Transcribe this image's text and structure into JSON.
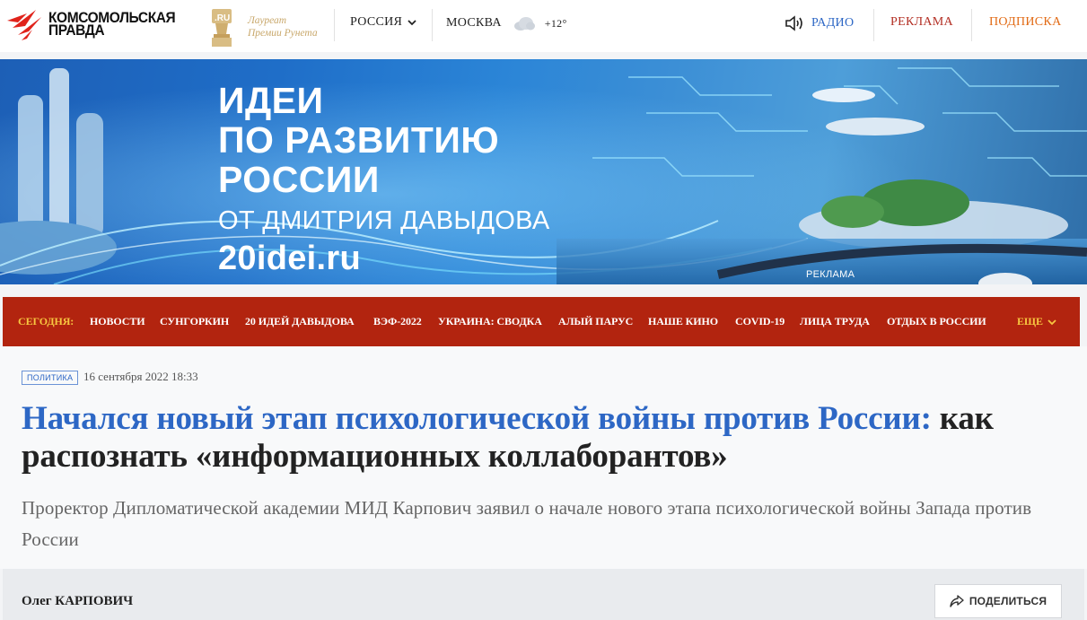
{
  "header": {
    "logo_line1": "КОМСОМОЛЬСКАЯ",
    "logo_line2": "ПРАВДА",
    "award_badge": ".RU",
    "award_line1": "Лауреат",
    "award_line2": "Премии Рунета",
    "region": "РОССИЯ",
    "city": "МОСКВА",
    "temperature": "+12°",
    "radio": "РАДИО",
    "reklama": "РЕКЛАМА",
    "podpiska": "ПОДПИСКА"
  },
  "banner": {
    "line1": "ИДЕИ",
    "line2": "ПО РАЗВИТИЮ",
    "line3": "РОССИИ",
    "line4": "ОТ ДМИТРИЯ ДАВЫДОВА",
    "url": "20idei.ru",
    "ad_label": "РЕКЛАМА"
  },
  "nav": {
    "today": "СЕГОДНЯ:",
    "items": [
      "НОВОСТИ",
      "СУНГОРКИН",
      "20 ИДЕЙ ДАВЫДОВА",
      "ВЭФ-2022",
      "УКРАИНА: СВОДКА",
      "АЛЫЙ ПАРУС",
      "НАШЕ КИНО",
      "COVID-19",
      "ЛИЦА ТРУДА",
      "ОТДЫХ В РОССИИ"
    ],
    "more": "ЕЩЕ"
  },
  "article": {
    "rubric": "ПОЛИТИКА",
    "date": "16 сентября 2022 18:33",
    "headline_blue": "Начался новый этап психологической войны против России:",
    "headline_rest": "как распознать «информационных коллаборантов»",
    "lead": "Проректор Дипломатической академии МИД Карпович заявил о начале нового этапа психологической войны Запада против России",
    "author": "Олег КАРПОВИЧ",
    "share": "ПОДЕЛИТЬСЯ"
  },
  "colors": {
    "accent_blue": "#2d67c5",
    "nav_red": "#b2240f",
    "nav_highlight": "#f7c640",
    "reklama_red": "#b32f24",
    "podpiska_orange": "#e26a14"
  },
  "icons": [
    "kp-bird-logo-icon",
    "runet-award-icon",
    "chevron-down-icon",
    "cloud-icon",
    "speaker-icon",
    "share-icon"
  ]
}
